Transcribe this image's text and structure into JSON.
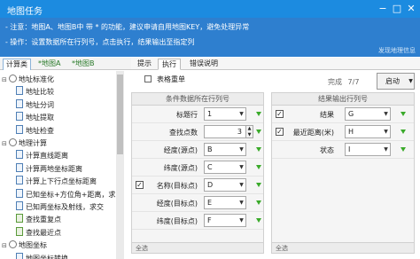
{
  "window": {
    "title": "地图任务"
  },
  "notice": {
    "line1": "- 注意：地图A、地图B中 带 * 的功能，建议申请自用地图KEY，避免处理异常",
    "line2": "- 操作：设置数据所在行列号，点击执行，结果输出至指定列",
    "feedback": "发现地理信息"
  },
  "left_tabs": [
    "计算类",
    "*地图A",
    "*地图B"
  ],
  "tree": [
    {
      "label": "地址标准化",
      "level": 0,
      "toggle": "⊟"
    },
    {
      "label": "地址比较",
      "level": 1
    },
    {
      "label": "地址分词",
      "level": 1
    },
    {
      "label": "地址提取",
      "level": 1
    },
    {
      "label": "地址检查",
      "level": 1
    },
    {
      "label": "地理计算",
      "level": 0,
      "toggle": "⊟"
    },
    {
      "label": "计算直线距离",
      "level": 1
    },
    {
      "label": "计算两地坐标距离",
      "level": 1
    },
    {
      "label": "计算上下行点坐标距离",
      "level": 1
    },
    {
      "label": "已知坐标+方位角+距离，求",
      "level": 1
    },
    {
      "label": "已知两坐标及射线，求交",
      "level": 1
    },
    {
      "label": "查找重复点",
      "level": 1,
      "q": true
    },
    {
      "label": "查找最近点",
      "level": 1,
      "q": true
    },
    {
      "label": "地图坐标",
      "level": 0,
      "toggle": "⊟"
    },
    {
      "label": "地图坐标转换",
      "level": 1
    }
  ],
  "right_tabs": [
    "提示",
    "执行",
    "错误说明"
  ],
  "toolbar": {
    "reset_label": "表格重单",
    "progress_label": "完成",
    "progress_value": "7/7",
    "start_label": "启动"
  },
  "left_grid": {
    "header": "条件数据所在行列号",
    "rows": [
      {
        "label": "标题行",
        "value": "1",
        "checkbox": false
      },
      {
        "label": "查找点数",
        "value": "3",
        "checkbox": false,
        "spin": true
      },
      {
        "label": "经度(源点)",
        "value": "B",
        "checkbox": false
      },
      {
        "label": "纬度(源点)",
        "value": "C",
        "checkbox": false
      },
      {
        "label": "名称(目标点)",
        "value": "D",
        "checkbox": true
      },
      {
        "label": "经度(目标点)",
        "value": "E",
        "checkbox": false
      },
      {
        "label": "纬度(目标点)",
        "value": "F",
        "checkbox": false
      }
    ],
    "footer": "全选"
  },
  "right_grid": {
    "header": "结果输出行列号",
    "rows": [
      {
        "label": "结果",
        "value": "G",
        "checkbox": true
      },
      {
        "label": "最近距离(米)",
        "value": "H",
        "checkbox": true
      },
      {
        "label": "状态",
        "value": "I",
        "checkbox": false
      }
    ],
    "footer": "全选"
  },
  "colors": {
    "titlebar": "#1c8be0",
    "notice_bg": "#2e7fcf",
    "accent_green": "#3aaa2a"
  }
}
